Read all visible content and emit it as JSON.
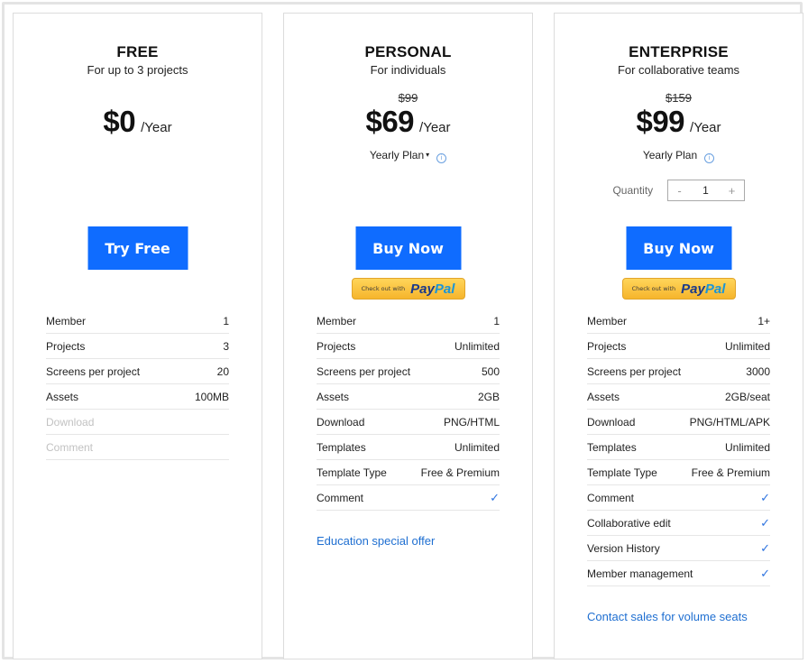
{
  "plans": [
    {
      "name": "FREE",
      "subtitle": "For up to 3 projects",
      "price": "$0",
      "period": "/Year",
      "cta": "Try Free",
      "features": [
        {
          "label": "Member",
          "value": "1",
          "enabled": true
        },
        {
          "label": "Projects",
          "value": "3",
          "enabled": true
        },
        {
          "label": "Screens per project",
          "value": "20",
          "enabled": true
        },
        {
          "label": "Assets",
          "value": "100MB",
          "enabled": true
        },
        {
          "label": "Download",
          "value": "",
          "enabled": false
        },
        {
          "label": "Comment",
          "value": "",
          "enabled": false
        }
      ]
    },
    {
      "name": "PERSONAL",
      "subtitle": "For individuals",
      "old_price": "$99",
      "price": "$69",
      "period": "/Year",
      "plan_select": "Yearly Plan",
      "cta": "Buy Now",
      "paypal": {
        "prefix": "Check out with",
        "brand_a": "Pay",
        "brand_b": "Pal"
      },
      "features": [
        {
          "label": "Member",
          "value": "1"
        },
        {
          "label": "Projects",
          "value": "Unlimited"
        },
        {
          "label": "Screens per project",
          "value": "500"
        },
        {
          "label": "Assets",
          "value": "2GB"
        },
        {
          "label": "Download",
          "value": "PNG/HTML"
        },
        {
          "label": "Templates",
          "value": "Unlimited"
        },
        {
          "label": "Template Type",
          "value": "Free & Premium"
        },
        {
          "label": "Comment",
          "value": "✓"
        }
      ],
      "link": "Education special offer"
    },
    {
      "name": "ENTERPRISE",
      "subtitle": "For collaborative teams",
      "old_price": "$159",
      "price": "$99",
      "period": "/Year",
      "plan_select": "Yearly Plan",
      "quantity": {
        "label": "Quantity",
        "minus": "-",
        "value": "1",
        "plus": "+"
      },
      "cta": "Buy Now",
      "paypal": {
        "prefix": "Check out with",
        "brand_a": "Pay",
        "brand_b": "Pal"
      },
      "features": [
        {
          "label": "Member",
          "value": "1+"
        },
        {
          "label": "Projects",
          "value": "Unlimited"
        },
        {
          "label": "Screens per project",
          "value": "3000"
        },
        {
          "label": "Assets",
          "value": "2GB/seat"
        },
        {
          "label": "Download",
          "value": "PNG/HTML/APK"
        },
        {
          "label": "Templates",
          "value": "Unlimited"
        },
        {
          "label": "Template Type",
          "value": "Free & Premium"
        },
        {
          "label": "Comment",
          "value": "✓"
        },
        {
          "label": "Collaborative edit",
          "value": "✓"
        },
        {
          "label": "Version History",
          "value": "✓"
        },
        {
          "label": "Member management",
          "value": "✓"
        }
      ],
      "link": "Contact sales for volume seats"
    }
  ],
  "icons": {
    "info": "i",
    "caret": "▾",
    "check": "✓"
  },
  "colors": {
    "primary": "#0f6cff",
    "link": "#1f6fd1",
    "check": "#2f74e0",
    "paypal_yellow": "#f6b52c"
  }
}
